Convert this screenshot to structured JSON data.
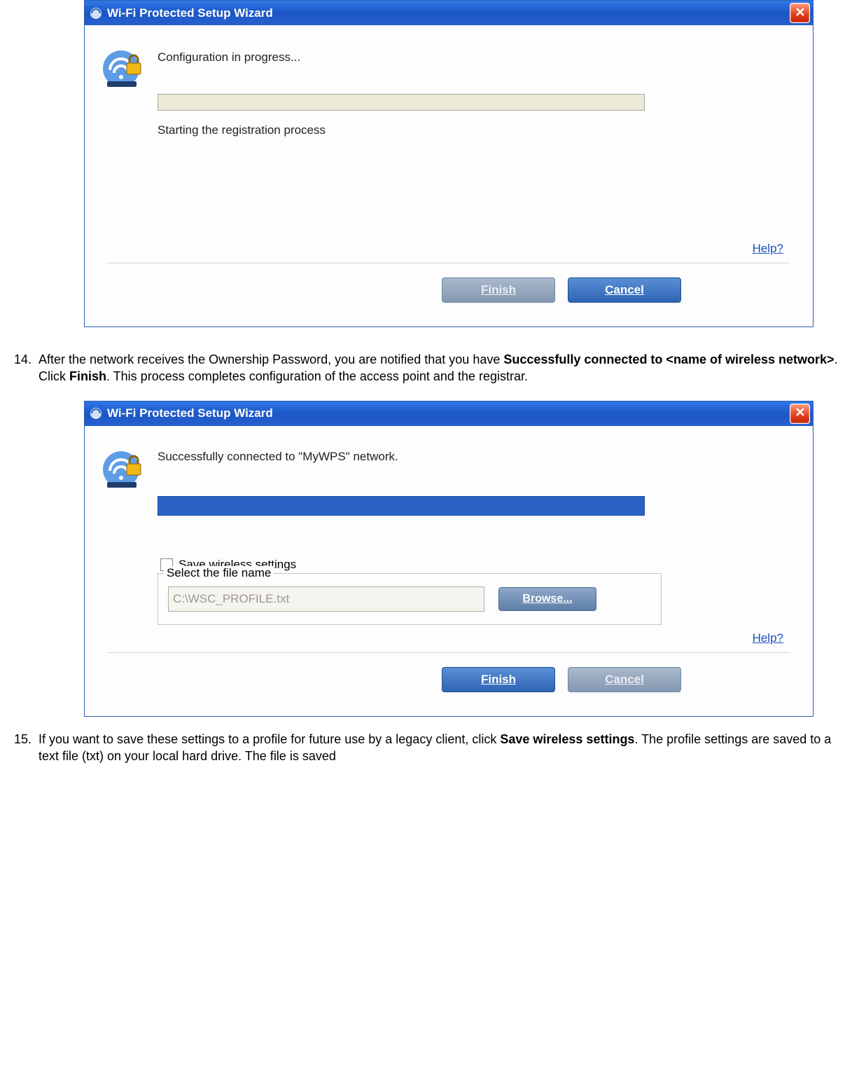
{
  "dialog1": {
    "title": "Wi-Fi Protected Setup Wizard",
    "status": "Configuration in progress...",
    "substatus": "Starting the registration process",
    "help": "Help?",
    "finish": "Finish",
    "cancel": "Cancel"
  },
  "step14": {
    "num": "14.",
    "t1": "After the network receives the Ownership Password, you are notified that you have ",
    "b1": "Successfully connected to <name of wireless network>",
    "t2": ". Click ",
    "b2": "Finish",
    "t3": ". This process completes configuration of the access point and the registrar."
  },
  "dialog2": {
    "title": "Wi-Fi Protected Setup Wizard",
    "status": "Successfully connected to \"MyWPS\" network.",
    "save_label": "Save wireless settings",
    "group_label": "Select the file name",
    "file_value": "C:\\WSC_PROFILE.txt",
    "browse": "Browse...",
    "help": "Help?",
    "finish": "Finish",
    "cancel": "Cancel"
  },
  "step15": {
    "num": "15.",
    "t1": "If you want to save these settings to a profile for future use by a legacy client, click ",
    "b1": "Save wireless settings",
    "t2": ". The profile settings are saved to a text file (txt) on your local hard drive. The file is saved"
  }
}
